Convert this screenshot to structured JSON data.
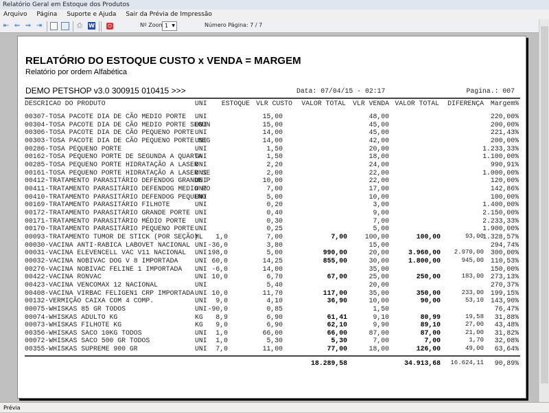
{
  "window": {
    "title": "Relatório Geral em Estoque dos Produtos"
  },
  "menu": [
    "Arquivo",
    "Página",
    "Suporte e Ajuda",
    "Sair da Prévia de Impressão"
  ],
  "toolbar": {
    "zoom_label": "Nº Zoom",
    "zoom_value": "1",
    "page_label": "Número Página: 7 / 7"
  },
  "report": {
    "title": "RELATÓRIO DO ESTOQUE CUSTO x VENDA = MARGEM",
    "subtitle": "Relatório por ordem Alfabética",
    "company": "DEMO PETSHOP v3.0 300915 010415 >>>",
    "date": "Data: 07/04/15 - 02:17",
    "page": "Pagina.: 007",
    "columns": [
      "DESCRICAO DO PRODUTO",
      "UNI",
      "ESTOQUE",
      "VLR CUSTO",
      "VALOR TOTAL",
      "VLR VENDA",
      "VALOR TOTAL",
      "DIFERENÇA",
      "Margem%"
    ],
    "rows": [
      [
        "00307-TOSA PACOTE DIA DE CÃO MEDIO PORTE",
        "UNI",
        "",
        "15,00",
        "",
        "48,00",
        "",
        "",
        "220,00%"
      ],
      [
        "00304-TOSA PACOTE DIA DE CÃO MEDIO PORTE SEGUN",
        "UNI",
        "",
        "15,00",
        "",
        "45,00",
        "",
        "",
        "200,00%"
      ],
      [
        "00306-TOSA PACOTE DIA DE CÃO PEQUENO PORTE",
        "UNI",
        "",
        "14,00",
        "",
        "45,00",
        "",
        "",
        "221,43%"
      ],
      [
        "00303-TOSA PACOTE DIA DE CÃO PEQUENO PORTE SEG",
        "UNI",
        "",
        "14,00",
        "",
        "42,00",
        "",
        "",
        "200,00%"
      ],
      [
        "00286-TOSA PEQUENO PORTE",
        "UNI",
        "",
        "1,50",
        "",
        "20,00",
        "",
        "",
        "1.233,33%"
      ],
      [
        "00162-TOSA PEQUENO PORTE DE SEGUNDA A QUARTA",
        "UNI",
        "",
        "1,50",
        "",
        "18,00",
        "",
        "",
        "1.100,00%"
      ],
      [
        "00285-TOSA PEQUENO PORTE HIDRATAÇÃO A LASER",
        "UNI",
        "",
        "2,20",
        "",
        "24,00",
        "",
        "",
        "990,91%"
      ],
      [
        "00161-TOSA PEQUENO PORTE HIDRATAÇÃO A LASER SE",
        "UNI",
        "",
        "2,00",
        "",
        "22,00",
        "",
        "",
        "1.000,00%"
      ],
      [
        "00412-TRATAMENTO PARASITÁRIO DEFENDOG GRANDE P",
        "UNI",
        "",
        "10,00",
        "",
        "22,00",
        "",
        "",
        "120,00%"
      ],
      [
        "00411-TRATAMENTO PARASITÁRIO DEFENDOG MEDIO PO",
        "UNI",
        "",
        "7,00",
        "",
        "17,00",
        "",
        "",
        "142,86%"
      ],
      [
        "00410-TRATAMENTO PARASITÁRIO DEFENDOG PEQUENO",
        "UNI",
        "",
        "5,00",
        "",
        "10,00",
        "",
        "",
        "100,00%"
      ],
      [
        "00169-TRATAMENTO PARASITÁRIO FILHOTE",
        "UNI",
        "",
        "0,20",
        "",
        "3,00",
        "",
        "",
        "1.400,00%"
      ],
      [
        "00172-TRATAMENTO PARASITÁRIO GRANDE PORTE",
        "UNI",
        "",
        "0,40",
        "",
        "9,00",
        "",
        "",
        "2.150,00%"
      ],
      [
        "00171-TRATAMENTO PARASITÁRIO MÉDIO PORTE",
        "UNI",
        "",
        "0,30",
        "",
        "7,00",
        "",
        "",
        "2.233,33%"
      ],
      [
        "00170-TRATAMENTO PARASITÁRIO PEQUENO PORTE",
        "UNI",
        "",
        "0,25",
        "",
        "5,00",
        "",
        "",
        "1.900,00%"
      ],
      [
        "00093-TRATAMENTO TUMOR DE STICK (POR SEÇÃO)",
        "ML",
        "1,0",
        "7,00",
        "7,00",
        "100,00",
        "100,00",
        "93,00",
        "1.328,57%"
      ],
      [
        "00030-VACINA ANTI-RABICA LABOVET NACIONAL",
        "UNI",
        "-36,0",
        "3,80",
        "",
        "15,00",
        "",
        "",
        "294,74%"
      ],
      [
        "00031-VACINA ELEVENCELL VAC V11 NACIONAL",
        "UNI",
        "198,0",
        "5,00",
        "990,00",
        "20,00",
        "3.960,00",
        "2.970,00",
        "300,00%"
      ],
      [
        "00032-VACINA NOBIVAC DOG V 8 IMPORTADA",
        "UNI",
        "60,0",
        "14,25",
        "855,00",
        "30,00",
        "1.800,00",
        "945,00",
        "110,53%"
      ],
      [
        "00276-VACINA NOBIVAC FELINE 1 IMPORTADA",
        "UNI",
        "-6,0",
        "14,00",
        "",
        "35,00",
        "",
        "",
        "150,00%"
      ],
      [
        "00422-VACINA RONVAC",
        "UNI",
        "10,0",
        "6,70",
        "67,00",
        "25,00",
        "250,00",
        "183,00",
        "273,13%"
      ],
      [
        "00423-VACINA VENCOMAX 12 NACIONAL",
        "UNI",
        "",
        "5,40",
        "",
        "20,00",
        "",
        "",
        "270,37%"
      ],
      [
        "00408-VACINA VIRBAC FELIGEN1 CRP IMPORTADA",
        "UNI",
        "10,0",
        "11,70",
        "117,00",
        "35,00",
        "350,00",
        "233,00",
        "199,15%"
      ],
      [
        "00132-VERMIÇÃO CAIXA COM 4 COMP.",
        "UNI",
        "9,0",
        "4,10",
        "36,90",
        "10,00",
        "90,00",
        "53,10",
        "143,90%"
      ],
      [
        "00075-WHISKAS 85 GR TODOS",
        "UNI",
        "-90,0",
        "0,85",
        "",
        "1,50",
        "",
        "",
        "76,47%"
      ],
      [
        "00074-WHISKAS ADULTO KG",
        "KG",
        "8,9",
        "6,90",
        "61,41",
        "9,10",
        "80,99",
        "19,58",
        "31,88%"
      ],
      [
        "00073-WHISKAS FILHOTE KG",
        "KG",
        "9,0",
        "6,90",
        "62,10",
        "9,90",
        "89,10",
        "27,00",
        "43,48%"
      ],
      [
        "00356-WHISKAS SACO 10KG TODOS",
        "UNI",
        "1,0",
        "66,00",
        "66,00",
        "87,00",
        "87,00",
        "21,00",
        "31,82%"
      ],
      [
        "00072-WHISKAS SACO 500 GR TODOS",
        "UNI",
        "1,0",
        "5,30",
        "5,30",
        "7,00",
        "7,00",
        "1,70",
        "32,08%"
      ],
      [
        "00355-WHISKAS SUPREME 900 GR",
        "UNI",
        "7,0",
        "11,00",
        "77,00",
        "18,00",
        "126,00",
        "49,00",
        "63,64%"
      ]
    ],
    "totals": {
      "valor_total_custo": "18.289,58",
      "valor_total_venda": "34.913,68",
      "diferenca": "16.624,11",
      "margem": "90,89%"
    }
  },
  "status": {
    "text": "Prévia"
  }
}
